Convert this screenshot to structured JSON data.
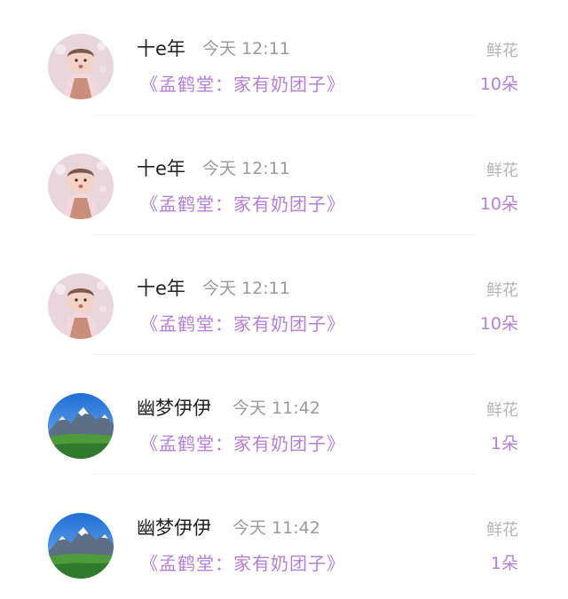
{
  "records": [
    {
      "name": "十e年",
      "time": "今天 12:11",
      "book": "《孟鹤堂：家有奶团子》",
      "gift_label": "鲜花",
      "gift_count": "10朵",
      "avatar": "child-photo-avatar"
    },
    {
      "name": "十e年",
      "time": "今天 12:11",
      "book": "《孟鹤堂：家有奶团子》",
      "gift_label": "鲜花",
      "gift_count": "10朵",
      "avatar": "child-photo-avatar"
    },
    {
      "name": "十e年",
      "time": "今天 12:11",
      "book": "《孟鹤堂：家有奶团子》",
      "gift_label": "鲜花",
      "gift_count": "10朵",
      "avatar": "child-photo-avatar"
    },
    {
      "name": "幽梦伊伊",
      "time": "今天 11:42",
      "book": "《孟鹤堂：家有奶团子》",
      "gift_label": "鲜花",
      "gift_count": "1朵",
      "avatar": "mountain-landscape-avatar"
    },
    {
      "name": "幽梦伊伊",
      "time": "今天 11:42",
      "book": "《孟鹤堂：家有奶团子》",
      "gift_label": "鲜花",
      "gift_count": "1朵",
      "avatar": "mountain-landscape-avatar"
    }
  ],
  "colors": {
    "accent": "#b57fd6",
    "name": "#222222",
    "muted": "#9a9a9a",
    "gift_label": "#b3b3b3"
  }
}
